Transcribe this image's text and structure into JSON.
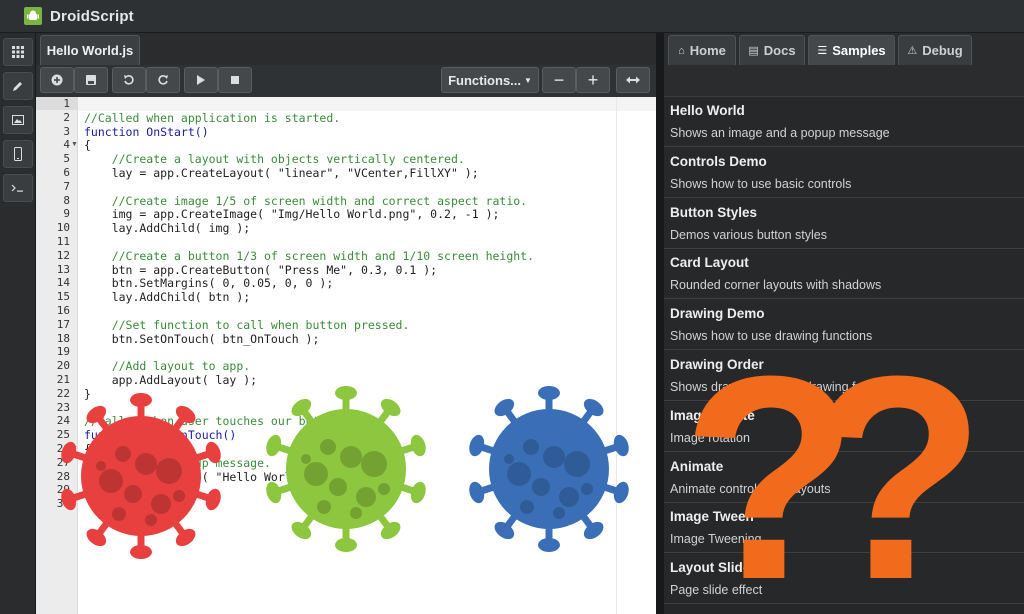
{
  "app": {
    "title": "DroidScript"
  },
  "editor": {
    "tab_label": "Hello World.js",
    "functions_label": "Functions...",
    "line_numbers": [
      "1",
      "2",
      "3",
      "4",
      "5",
      "6",
      "7",
      "8",
      "9",
      "10",
      "11",
      "12",
      "13",
      "14",
      "15",
      "16",
      "17",
      "18",
      "19",
      "20",
      "21",
      "22",
      "23",
      "24",
      "25",
      "26",
      "27",
      "28",
      "29",
      "30"
    ],
    "code": [
      "",
      "//Called when application is started.",
      "function OnStart()",
      "{",
      "    //Create a layout with objects vertically centered.",
      "    lay = app.CreateLayout( \"linear\", \"VCenter,FillXY\" );",
      "",
      "    //Create image 1/5 of screen width and correct aspect ratio.",
      "    img = app.CreateImage( \"Img/Hello World.png\", 0.2, -1 );",
      "    lay.AddChild( img );",
      "",
      "    //Create a button 1/3 of screen width and 1/10 screen height.",
      "    btn = app.CreateButton( \"Press Me\", 0.3, 0.1 );",
      "    btn.SetMargins( 0, 0.05, 0, 0 );",
      "    lay.AddChild( btn );",
      "",
      "    //Set function to call when button pressed.",
      "    btn.SetOnTouch( btn_OnTouch );",
      "",
      "    //Add layout to app.",
      "    app.AddLayout( lay );",
      "}",
      "",
      "//Called when user touches our button.",
      "function btn_OnTouch()",
      "{",
      "    //Show a popup message.",
      "    app.ShowPopup( \"Hello World!\" );",
      "}",
      ""
    ]
  },
  "right_panel": {
    "tabs": [
      {
        "label": "Home",
        "icon": "home-icon"
      },
      {
        "label": "Docs",
        "icon": "docs-icon"
      },
      {
        "label": "Samples",
        "icon": "samples-icon"
      },
      {
        "label": "Debug",
        "icon": "debug-icon"
      }
    ],
    "active_tab": "Samples",
    "samples": [
      {
        "title": "Hello World",
        "desc": "Shows an image and a popup message"
      },
      {
        "title": "Controls Demo",
        "desc": "Shows how to use basic controls"
      },
      {
        "title": "Button Styles",
        "desc": "Demos various button styles"
      },
      {
        "title": "Card Layout",
        "desc": "Rounded corner layouts with shadows"
      },
      {
        "title": "Drawing Demo",
        "desc": "Shows how to use drawing functions"
      },
      {
        "title": "Drawing Order",
        "desc": "Shows drawing order of drawing functions"
      },
      {
        "title": "Image Rotate",
        "desc": "Image rotation"
      },
      {
        "title": "Animate",
        "desc": "Animate controls and layouts"
      },
      {
        "title": "Image Tween",
        "desc": "Image Tweening"
      },
      {
        "title": "Layout Slide",
        "desc": "Page slide effect"
      }
    ]
  },
  "overlay": {
    "virus_colors": [
      "#e8403f",
      "#8dc63f",
      "#3a6fb8"
    ],
    "question_color": "#f26a1b",
    "question_mark": "?"
  }
}
